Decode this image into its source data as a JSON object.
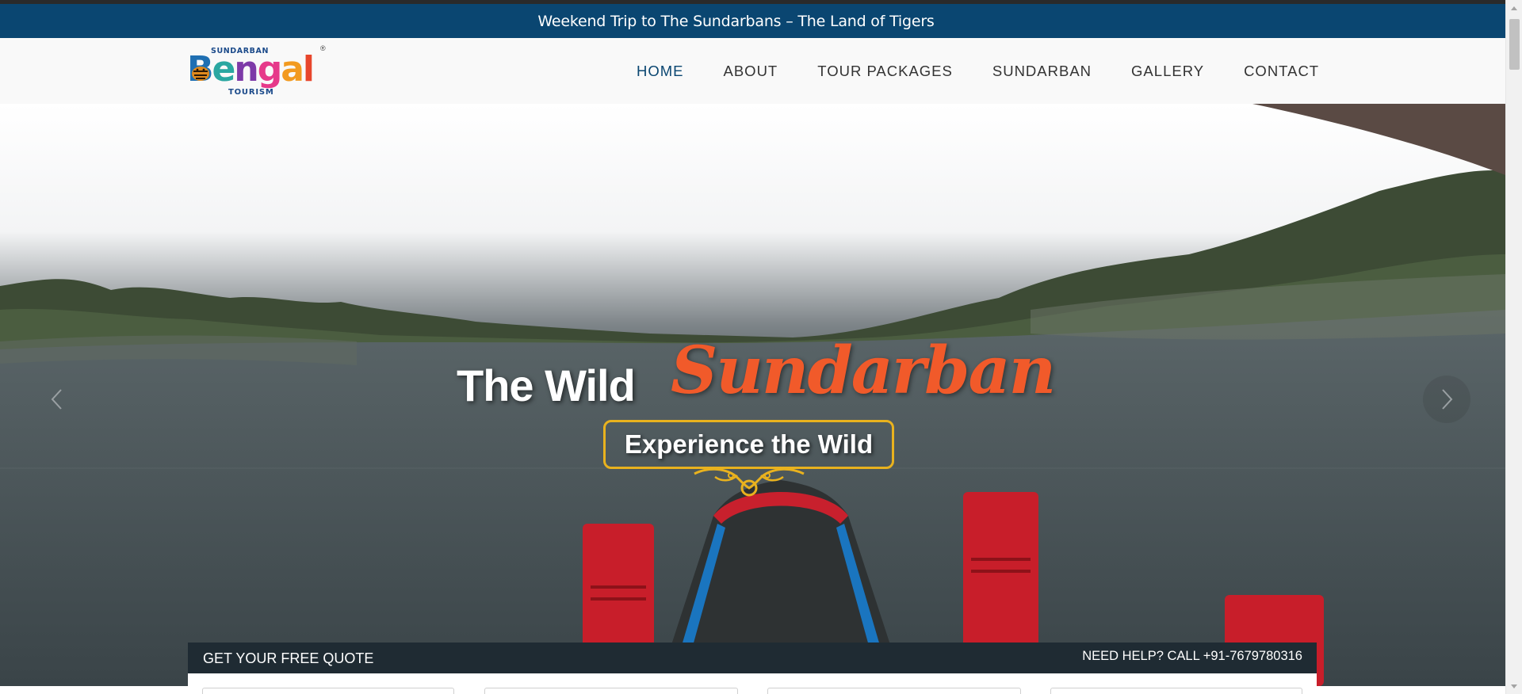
{
  "announcement": {
    "text": "Weekend Trip to The Sundarbans – The Land of Tigers"
  },
  "logo": {
    "top_text": "SUNDARBAN",
    "main_text": "Bengal",
    "bottom_text": "TOURISM",
    "registered_mark": "®"
  },
  "nav": {
    "items": [
      {
        "label": "HOME",
        "active": true
      },
      {
        "label": "ABOUT",
        "active": false
      },
      {
        "label": "TOUR PACKAGES",
        "active": false
      },
      {
        "label": "SUNDARBAN",
        "active": false
      },
      {
        "label": "GALLERY",
        "active": false
      },
      {
        "label": "CONTACT",
        "active": false
      }
    ]
  },
  "hero": {
    "headline_plain": "The Wild",
    "headline_script": "Sundarban",
    "tagline": "Experience the Wild",
    "prev_icon": "chevron-left-icon",
    "next_icon": "chevron-right-icon"
  },
  "quote_bar": {
    "left_label": "GET YOUR FREE QUOTE",
    "help_label": "NEED HELP? CALL +91-7679780316"
  },
  "colors": {
    "announce_bg": "#0a4671",
    "nav_active": "#0a4671",
    "nav_text": "#333333",
    "script_accent": "#f15a2a",
    "tagline_border": "#e9b21e",
    "quote_bar_bg": "#1f2b33"
  }
}
